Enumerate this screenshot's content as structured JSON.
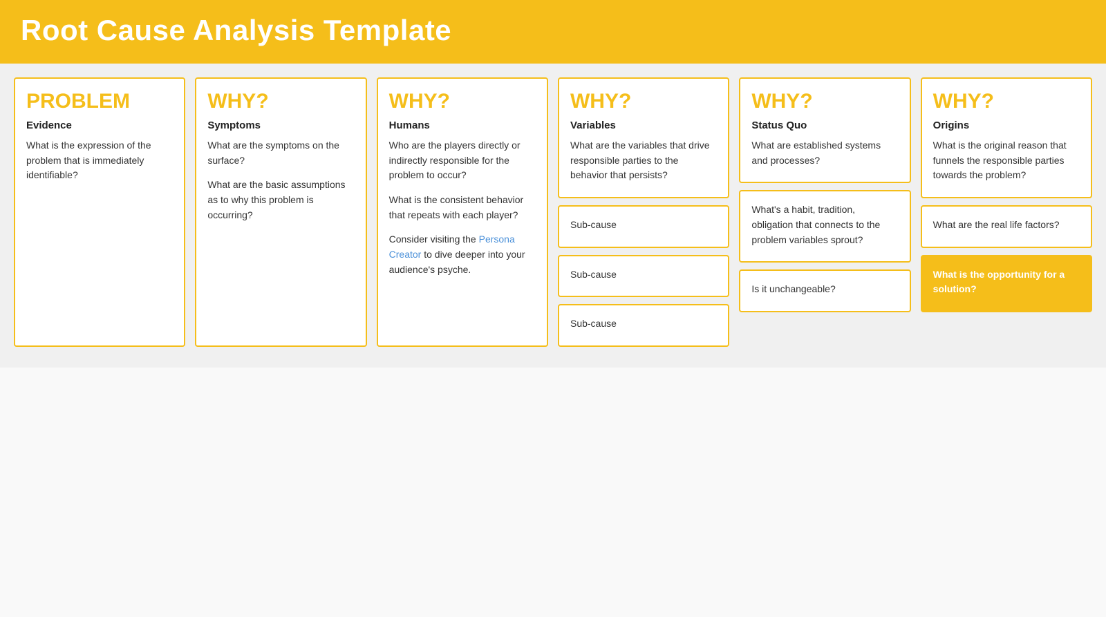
{
  "header": {
    "title": "Root Cause Analysis Template"
  },
  "columns": [
    {
      "id": "problem",
      "heading": "PROBLEM",
      "cards": [
        {
          "id": "problem-main",
          "subheading": "Evidence",
          "paragraphs": [
            "What is the expression of the problem that is immediately identifiable?"
          ],
          "highlight": false
        }
      ]
    },
    {
      "id": "why1",
      "heading": "WHY?",
      "cards": [
        {
          "id": "why1-main",
          "subheading": "Symptoms",
          "paragraphs": [
            "What are the symptoms on the surface?",
            "What are the basic assumptions as to why this problem is occurring?"
          ],
          "highlight": false
        }
      ]
    },
    {
      "id": "why2",
      "heading": "WHY?",
      "cards": [
        {
          "id": "why2-main",
          "subheading": "Humans",
          "paragraphs": [
            "Who are the players directly or indirectly responsible for the problem to occur?",
            "What is the consistent behavior that repeats with each player?",
            "Consider visiting the Persona Creator to dive deeper into your audience's psyche."
          ],
          "has_link": true,
          "link_text": "Persona Creator",
          "link_before": "Consider visiting the ",
          "link_after": " to dive deeper into your audience's psyche.",
          "highlight": false
        }
      ]
    },
    {
      "id": "why3",
      "heading": "WHY?",
      "cards": [
        {
          "id": "why3-main",
          "subheading": "Variables",
          "paragraphs": [
            "What are the variables that drive responsible parties to the behavior that persists?"
          ],
          "highlight": false
        },
        {
          "id": "why3-sub1",
          "text": "Sub-cause",
          "highlight": false
        },
        {
          "id": "why3-sub2",
          "text": "Sub-cause",
          "highlight": false
        },
        {
          "id": "why3-sub3",
          "text": "Sub-cause",
          "highlight": false
        }
      ]
    },
    {
      "id": "why4",
      "heading": "WHY?",
      "cards": [
        {
          "id": "why4-main",
          "subheading": "Status Quo",
          "paragraphs": [
            "What are established systems and processes?"
          ],
          "highlight": false
        },
        {
          "id": "why4-sub1",
          "text": "What's a habit, tradition, obligation that connects to the problem variables sprout?",
          "highlight": false
        },
        {
          "id": "why4-sub2",
          "text": "Is it unchangeable?",
          "highlight": false
        }
      ]
    },
    {
      "id": "why5",
      "heading": "WHY?",
      "cards": [
        {
          "id": "why5-main",
          "subheading": "Origins",
          "paragraphs": [
            "What is the original reason that funnels the responsible parties towards the problem?"
          ],
          "highlight": false
        },
        {
          "id": "why5-sub1",
          "text": "What are the real life factors?",
          "highlight": false
        },
        {
          "id": "why5-sub2",
          "text": "What is the opportunity for a solution?",
          "highlight": true
        }
      ]
    }
  ]
}
